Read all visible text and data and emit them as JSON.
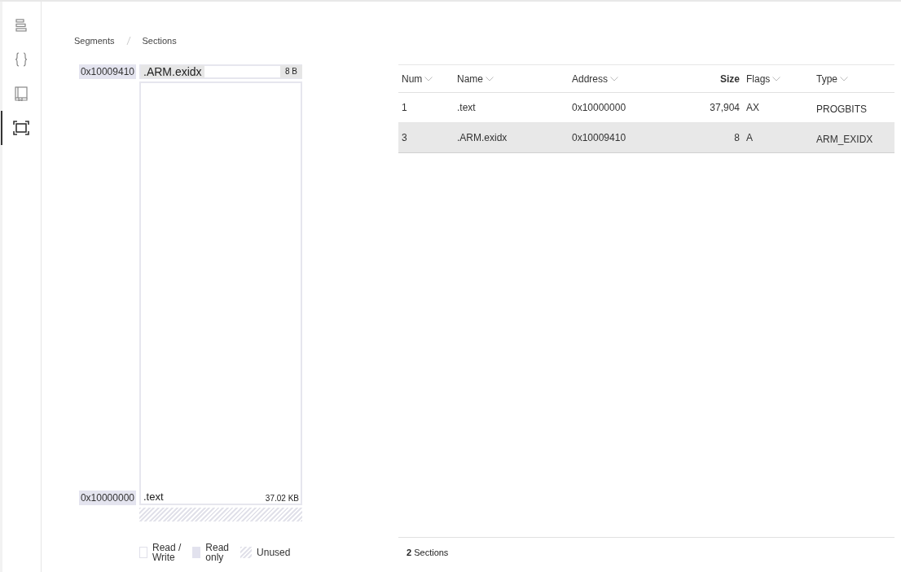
{
  "nav": [
    {
      "selected": false
    },
    {
      "selected": false
    },
    {
      "selected": false
    },
    {
      "selected": true
    }
  ],
  "breadcrumb": [
    "Segments",
    "Sections"
  ],
  "memory_map": {
    "top": {
      "address": "0x10009410",
      "name": ".ARM.exidx",
      "size": "8 B"
    },
    "main": {
      "address": "0x10000000",
      "name": ".text",
      "size": "37.02 KB"
    },
    "unused": true,
    "legend": [
      {
        "kind": "read-write",
        "label": "Read /\nWrite"
      },
      {
        "kind": "read-only",
        "label": "Read\nonly"
      },
      {
        "kind": "unused",
        "label": "Unused"
      }
    ]
  },
  "table": {
    "columns": [
      {
        "label": "Num",
        "sorted": false
      },
      {
        "label": "Name",
        "sorted": false
      },
      {
        "label": "Address",
        "sorted": false
      },
      {
        "label": "Size",
        "sorted": true
      },
      {
        "label": "Flags",
        "sorted": false
      },
      {
        "label": "Type",
        "sorted": false
      }
    ],
    "rows": [
      {
        "cells": [
          "1",
          ".text",
          "0x10000000",
          "37,904",
          "AX",
          "PROGBITS"
        ],
        "selected": false
      },
      {
        "cells": [
          "3",
          ".ARM.exidx",
          "0x10009410",
          "8",
          "A",
          "ARM_EXIDX"
        ],
        "selected": true
      }
    ]
  },
  "footer": "**2** Sections"
}
